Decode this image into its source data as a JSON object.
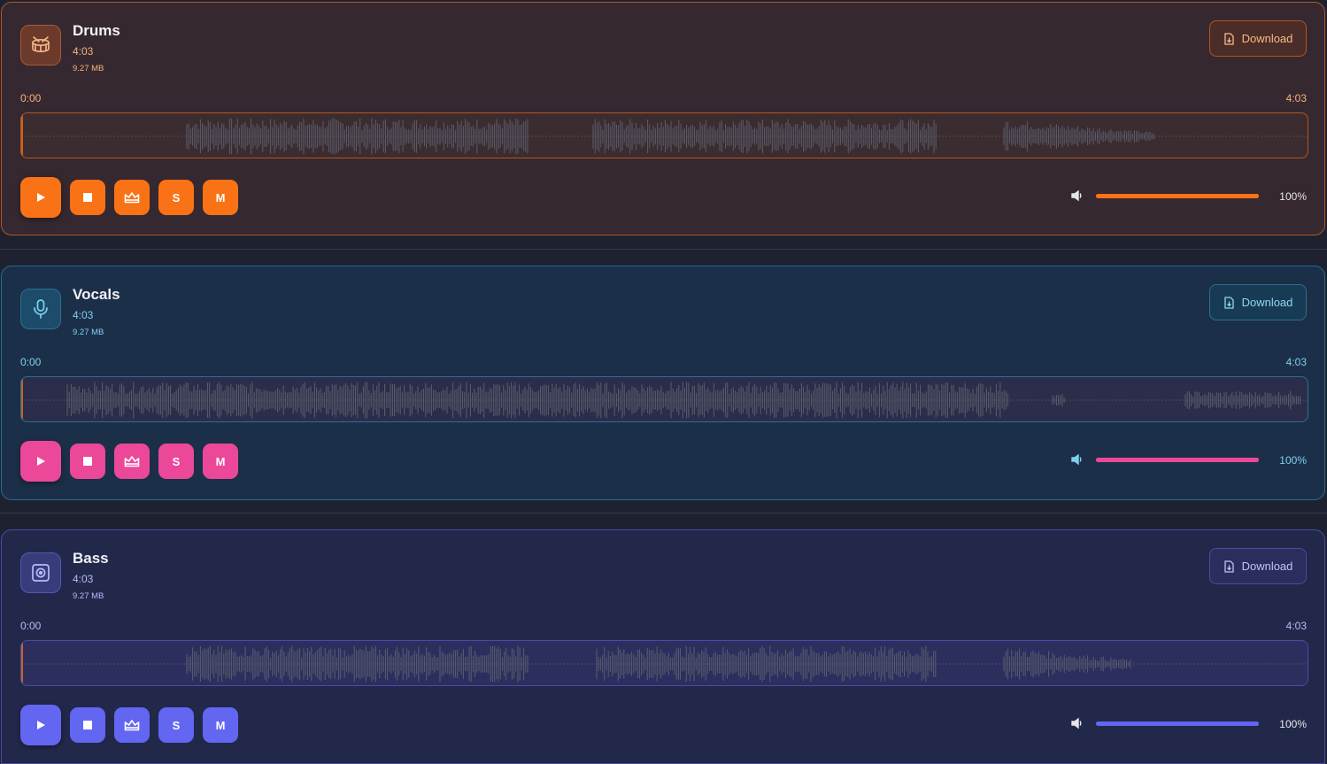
{
  "tracks": [
    {
      "name": "Drums",
      "duration": "4:03",
      "size": "9.27 MB",
      "download_label": "Download",
      "time_start": "0:00",
      "time_end": "4:03",
      "solo_label": "S",
      "mute_label": "M",
      "volume": "100%",
      "volume_level": 1.0,
      "icon": "drum-icon",
      "colors": {
        "accent": "#f97316",
        "bg": "#352830",
        "border": "#b4551f",
        "meta": "#f5b27a",
        "iconbg": "#6b3a2a",
        "iconborder": "#a85c34",
        "icon": "#f8b98a",
        "dlbg": "#4a2d28",
        "dlborder": "#b4551f",
        "dltext": "#f7b987",
        "wavebg": "#3b2c30",
        "waveborder": "#b4551f"
      }
    },
    {
      "name": "Vocals",
      "duration": "4:03",
      "size": "9.27 MB",
      "download_label": "Download",
      "time_start": "0:00",
      "time_end": "4:03",
      "solo_label": "S",
      "mute_label": "M",
      "volume": "100%",
      "volume_level": 1.0,
      "icon": "microphone-icon",
      "colors": {
        "accent": "#ec4899",
        "bg": "#1c2f48",
        "border": "#1f6e92",
        "meta": "#7fd0f0",
        "iconbg": "#1c4c6a",
        "iconborder": "#2b6f91",
        "icon": "#7fd0f0",
        "dlbg": "#183b55",
        "dlborder": "#2b6f91",
        "dltext": "#8fd6f2",
        "wavebg": "#2c2d4a",
        "waveborder": "#2b6f91"
      }
    },
    {
      "name": "Bass",
      "duration": "4:03",
      "size": "9.27 MB",
      "download_label": "Download",
      "time_start": "0:00",
      "time_end": "4:03",
      "solo_label": "S",
      "mute_label": "M",
      "volume": "100%",
      "volume_level": 1.0,
      "icon": "speaker-icon",
      "colors": {
        "accent": "#6366f1",
        "bg": "#22284a",
        "border": "#4a4aa8",
        "meta": "#b8bbf5",
        "iconbg": "#383c7a",
        "iconborder": "#5557b0",
        "icon": "#b8bbf5",
        "dlbg": "#2a2e5c",
        "dlborder": "#4a4aa8",
        "dltext": "#c0c3f7",
        "wavebg": "#2c2f5e",
        "waveborder": "#4a4aa8"
      }
    }
  ]
}
